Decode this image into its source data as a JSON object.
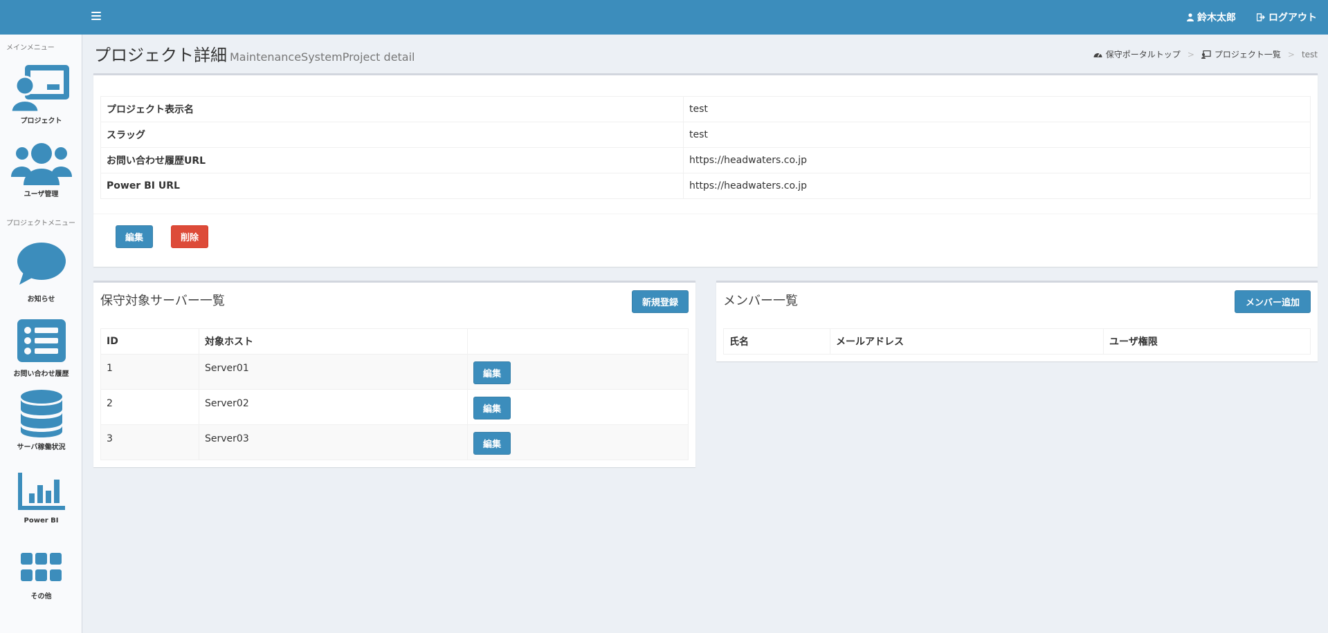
{
  "topbar": {
    "user_name": "鈴木太郎",
    "logout_label": "ログアウト"
  },
  "sidebar": {
    "main_menu_header": "メインメニュー",
    "project_menu_header": "プロジェクトメニュー",
    "items": [
      {
        "label": "プロジェクト",
        "icon": "project-presentation-icon"
      },
      {
        "label": "ユーザ管理",
        "icon": "users-icon"
      },
      {
        "label": "お知らせ",
        "icon": "speech-bubble-icon"
      },
      {
        "label": "お問い合わせ履歴",
        "icon": "list-icon"
      },
      {
        "label": "サーバ稼働状況",
        "icon": "database-icon"
      },
      {
        "label": "Power BI",
        "icon": "bar-chart-icon"
      },
      {
        "label": "その他",
        "icon": "grid-icon"
      }
    ]
  },
  "header": {
    "title": "プロジェクト詳細",
    "subtitle": "MaintenanceSystemProject detail"
  },
  "breadcrumb": [
    "保守ポータルトップ",
    "プロジェクト一覧",
    "test"
  ],
  "detail": {
    "rows": [
      {
        "key": "プロジェクト表示名",
        "value": "test"
      },
      {
        "key": "スラッグ",
        "value": "test"
      },
      {
        "key": "お問い合わせ履歴URL",
        "value": "https://headwaters.co.jp"
      },
      {
        "key": "Power BI URL",
        "value": "https://headwaters.co.jp"
      }
    ],
    "edit_label": "編集",
    "delete_label": "削除"
  },
  "servers": {
    "title": "保守対象サーバー一覧",
    "new_label": "新規登録",
    "columns": [
      "ID",
      "対象ホスト",
      ""
    ],
    "rows": [
      {
        "id": "1",
        "host": "Server01",
        "action": "編集"
      },
      {
        "id": "2",
        "host": "Server02",
        "action": "編集"
      },
      {
        "id": "3",
        "host": "Server03",
        "action": "編集"
      }
    ]
  },
  "members": {
    "title": "メンバー一覧",
    "add_label": "メンバー追加",
    "columns": [
      "氏名",
      "メールアドレス",
      "ユーザ権限"
    ]
  },
  "colors": {
    "primary": "#3c8dbc",
    "danger": "#dd4b39",
    "background": "#ecf0f5"
  }
}
